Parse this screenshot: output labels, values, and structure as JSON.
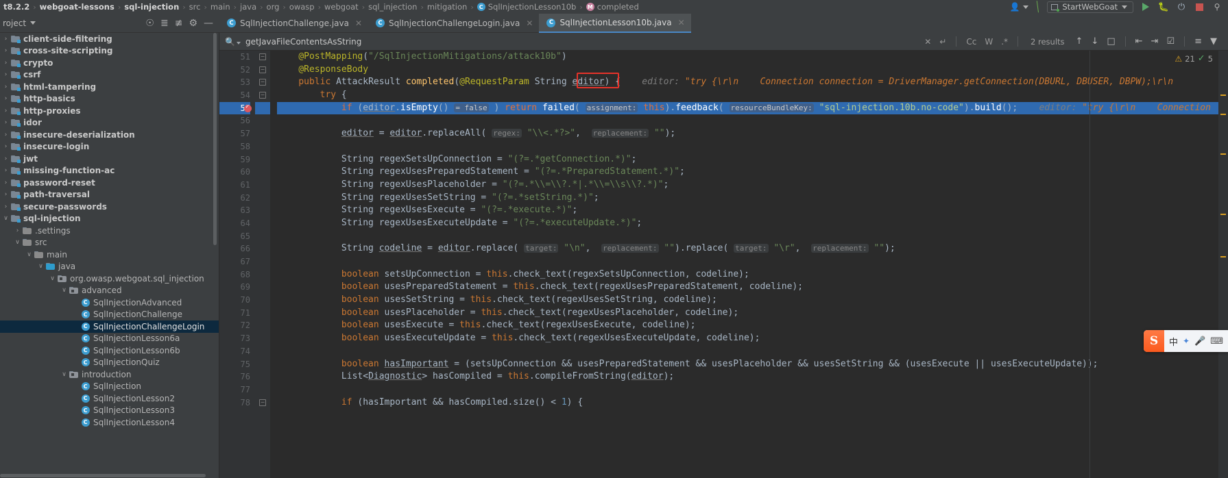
{
  "navbar": {
    "crumbs": [
      {
        "label": "t8.2.2",
        "bold": true,
        "icon": ""
      },
      {
        "label": "webgoat-lessons",
        "bold": true,
        "icon": ""
      },
      {
        "label": "sql-injection",
        "bold": true,
        "icon": ""
      },
      {
        "label": "src",
        "bold": false,
        "icon": ""
      },
      {
        "label": "main",
        "bold": false,
        "icon": ""
      },
      {
        "label": "java",
        "bold": false,
        "icon": ""
      },
      {
        "label": "org",
        "bold": false,
        "icon": ""
      },
      {
        "label": "owasp",
        "bold": false,
        "icon": ""
      },
      {
        "label": "webgoat",
        "bold": false,
        "icon": ""
      },
      {
        "label": "sql_injection",
        "bold": false,
        "icon": ""
      },
      {
        "label": "mitigation",
        "bold": false,
        "icon": ""
      },
      {
        "label": "SqlInjectionLesson10b",
        "bold": false,
        "icon": "c"
      },
      {
        "label": "completed",
        "bold": false,
        "icon": "m"
      }
    ],
    "run_config": "StartWebGoat"
  },
  "project_toolbar": {
    "title": "roject"
  },
  "tabs": [
    {
      "label": "SqlInjectionChallenge.java",
      "active": false
    },
    {
      "label": "SqlInjectionChallengeLogin.java",
      "active": false
    },
    {
      "label": "SqlInjectionLesson10b.java",
      "active": true
    }
  ],
  "search": {
    "query": "getJavaFileContentsAsString",
    "results": "2 results",
    "options": [
      "Cc",
      "W",
      ".*"
    ]
  },
  "tree": [
    {
      "label": "client-side-filtering",
      "indent": 0,
      "arrow": "right",
      "icon": "module",
      "bold": true
    },
    {
      "label": "cross-site-scripting",
      "indent": 0,
      "arrow": "right",
      "icon": "module",
      "bold": true
    },
    {
      "label": "crypto",
      "indent": 0,
      "arrow": "right",
      "icon": "module",
      "bold": true
    },
    {
      "label": "csrf",
      "indent": 0,
      "arrow": "right",
      "icon": "module",
      "bold": true
    },
    {
      "label": "html-tampering",
      "indent": 0,
      "arrow": "right",
      "icon": "module",
      "bold": true
    },
    {
      "label": "http-basics",
      "indent": 0,
      "arrow": "right",
      "icon": "module",
      "bold": true
    },
    {
      "label": "http-proxies",
      "indent": 0,
      "arrow": "right",
      "icon": "module",
      "bold": true
    },
    {
      "label": "idor",
      "indent": 0,
      "arrow": "right",
      "icon": "module",
      "bold": true
    },
    {
      "label": "insecure-deserialization",
      "indent": 0,
      "arrow": "right",
      "icon": "module",
      "bold": true
    },
    {
      "label": "insecure-login",
      "indent": 0,
      "arrow": "right",
      "icon": "module",
      "bold": true
    },
    {
      "label": "jwt",
      "indent": 0,
      "arrow": "right",
      "icon": "module",
      "bold": true
    },
    {
      "label": "missing-function-ac",
      "indent": 0,
      "arrow": "right",
      "icon": "module",
      "bold": true
    },
    {
      "label": "password-reset",
      "indent": 0,
      "arrow": "right",
      "icon": "module",
      "bold": true
    },
    {
      "label": "path-traversal",
      "indent": 0,
      "arrow": "right",
      "icon": "module",
      "bold": true
    },
    {
      "label": "secure-passwords",
      "indent": 0,
      "arrow": "right",
      "icon": "module",
      "bold": true
    },
    {
      "label": "sql-injection",
      "indent": 0,
      "arrow": "down",
      "icon": "module",
      "bold": true
    },
    {
      "label": ".settings",
      "indent": 1,
      "arrow": "right",
      "icon": "folder",
      "bold": false
    },
    {
      "label": "src",
      "indent": 1,
      "arrow": "down",
      "icon": "folder",
      "bold": false
    },
    {
      "label": "main",
      "indent": 2,
      "arrow": "down",
      "icon": "folder",
      "bold": false
    },
    {
      "label": "java",
      "indent": 3,
      "arrow": "down",
      "icon": "source",
      "bold": false
    },
    {
      "label": "org.owasp.webgoat.sql_injection",
      "indent": 4,
      "arrow": "down",
      "icon": "package",
      "bold": false
    },
    {
      "label": "advanced",
      "indent": 5,
      "arrow": "down",
      "icon": "package",
      "bold": false
    },
    {
      "label": "SqlInjectionAdvanced",
      "indent": 6,
      "arrow": "none",
      "icon": "class",
      "bold": false
    },
    {
      "label": "SqlInjectionChallenge",
      "indent": 6,
      "arrow": "none",
      "icon": "class",
      "bold": false
    },
    {
      "label": "SqlInjectionChallengeLogin",
      "indent": 6,
      "arrow": "none",
      "icon": "class",
      "bold": false,
      "selected": true
    },
    {
      "label": "SqlInjectionLesson6a",
      "indent": 6,
      "arrow": "none",
      "icon": "class",
      "bold": false
    },
    {
      "label": "SqlInjectionLesson6b",
      "indent": 6,
      "arrow": "none",
      "icon": "class",
      "bold": false
    },
    {
      "label": "SqlInjectionQuiz",
      "indent": 6,
      "arrow": "none",
      "icon": "class",
      "bold": false
    },
    {
      "label": "introduction",
      "indent": 5,
      "arrow": "down",
      "icon": "package",
      "bold": false
    },
    {
      "label": "SqlInjection",
      "indent": 6,
      "arrow": "none",
      "icon": "class",
      "bold": false
    },
    {
      "label": "SqlInjectionLesson2",
      "indent": 6,
      "arrow": "none",
      "icon": "class",
      "bold": false
    },
    {
      "label": "SqlInjectionLesson3",
      "indent": 6,
      "arrow": "none",
      "icon": "class",
      "bold": false
    },
    {
      "label": "SqlInjectionLesson4",
      "indent": 6,
      "arrow": "none",
      "icon": "class",
      "bold": false
    }
  ],
  "editor": {
    "first_line": 51,
    "highlighted_line": 55,
    "breakpoint_line": 55,
    "inspection": {
      "warnings": "21",
      "ok": "5"
    },
    "lines": [
      {
        "n": 51,
        "fold": "collapse",
        "html": "    <span class='ann'>@PostMapping</span>(<span class='str'>\"/SqlInjectionMitigations/attack10b\"</span>)"
      },
      {
        "n": 52,
        "fold": "collapse-top",
        "html": "    <span class='ann'>@ResponseBody</span>"
      },
      {
        "n": 53,
        "fold": "collapse",
        "html": "    <span class='kw'>public</span> <span class='ident'>AttackResult</span> <span class='fn'>completed</span>(<span class='ann'>@RequestParam</span> <span class='ident'>String</span> <span class='underl'>editor</span>) {    <span class='ghost'>editor:</span> <span class='ghost-o'>\"try {\\r\\n    Connection connection = DriverManager.getConnection(DBURL, DBUSER, DBPW);\\r\\n</span>"
      },
      {
        "n": 54,
        "fold": "collapse",
        "html": "        <span class='kw'>try</span> {"
      },
      {
        "n": 55,
        "fold": "",
        "hl": true,
        "html": "            <span class='kw'>if</span> (<span class='underl'>editor</span>.<span class='ident'>isEmpty</span>() <span class='inlayparam'>= false</span> ) <span class='kw'>return</span> <span class='ident'>failed</span>( <span class='inlayparam'>assignment:</span> <span class='kw'>this</span>).<span class='ident'>feedback</span>( <span class='inlayparam'>resourceBundleKey:</span> <span class='str'>\"sql-injection.10b.no-code\"</span>).<span class='ident'>build</span>();    <span class='ghost'>editor:</span> <span class='ghost-o'>\"try {\\r\\n    Connection</span>"
      },
      {
        "n": 56,
        "fold": "",
        "html": ""
      },
      {
        "n": 57,
        "fold": "",
        "html": "            <span class='underl'>editor</span> = <span class='underl'>editor</span>.<span class='ident'>replaceAll</span>( <span class='inlayparam'>regex:</span> <span class='str'>\"\\\\&lt;.*?&gt;\"</span>,  <span class='inlayparam'>replacement:</span> <span class='str'>\"\"</span>);"
      },
      {
        "n": 58,
        "fold": "",
        "html": ""
      },
      {
        "n": 59,
        "fold": "",
        "html": "            <span class='ident'>String</span> regexSetsUpConnection = <span class='str'>\"(?=.*getConnection.*)\"</span>;"
      },
      {
        "n": 60,
        "fold": "",
        "html": "            <span class='ident'>String</span> regexUsesPreparedStatement = <span class='str'>\"(?=.*PreparedStatement.*)\"</span>;"
      },
      {
        "n": 61,
        "fold": "",
        "html": "            <span class='ident'>String</span> regexUsesPlaceholder = <span class='str'>\"(?=.*\\\\=\\\\?.*|.*\\\\=\\\\s\\\\?.*)\"</span>;"
      },
      {
        "n": 62,
        "fold": "",
        "html": "            <span class='ident'>String</span> regexUsesSetString = <span class='str'>\"(?=.*setString.*)\"</span>;"
      },
      {
        "n": 63,
        "fold": "",
        "html": "            <span class='ident'>String</span> regexUsesExecute = <span class='str'>\"(?=.*execute.*)\"</span>;"
      },
      {
        "n": 64,
        "fold": "",
        "html": "            <span class='ident'>String</span> regexUsesExecuteUpdate = <span class='str'>\"(?=.*executeUpdate.*)\"</span>;"
      },
      {
        "n": 65,
        "fold": "",
        "html": ""
      },
      {
        "n": 66,
        "fold": "",
        "html": "            <span class='ident'>String</span> <span class='underl'>codeline</span> = <span class='underl'>editor</span>.<span class='ident'>replace</span>( <span class='inlayparam'>target:</span> <span class='str'>\"\\n\"</span>,  <span class='inlayparam'>replacement:</span> <span class='str'>\"\"</span>).<span class='ident'>replace</span>( <span class='inlayparam'>target:</span> <span class='str'>\"\\r\"</span>,  <span class='inlayparam'>replacement:</span> <span class='str'>\"\"</span>);"
      },
      {
        "n": 67,
        "fold": "",
        "html": ""
      },
      {
        "n": 68,
        "fold": "",
        "html": "            <span class='kw'>boolean</span> setsUpConnection = <span class='kw'>this</span>.<span class='ident'>check_text</span>(regexSetsUpConnection, codeline);"
      },
      {
        "n": 69,
        "fold": "",
        "html": "            <span class='kw'>boolean</span> usesPreparedStatement = <span class='kw'>this</span>.<span class='ident'>check_text</span>(regexUsesPreparedStatement, codeline);"
      },
      {
        "n": 70,
        "fold": "",
        "html": "            <span class='kw'>boolean</span> usesSetString = <span class='kw'>this</span>.<span class='ident'>check_text</span>(regexUsesSetString, codeline);"
      },
      {
        "n": 71,
        "fold": "",
        "html": "            <span class='kw'>boolean</span> usesPlaceholder = <span class='kw'>this</span>.<span class='ident'>check_text</span>(regexUsesPlaceholder, codeline);"
      },
      {
        "n": 72,
        "fold": "",
        "html": "            <span class='kw'>boolean</span> usesExecute = <span class='kw'>this</span>.<span class='ident'>check_text</span>(regexUsesExecute, codeline);"
      },
      {
        "n": 73,
        "fold": "",
        "html": "            <span class='kw'>boolean</span> usesExecuteUpdate = <span class='kw'>this</span>.<span class='ident'>check_text</span>(regexUsesExecuteUpdate, codeline);"
      },
      {
        "n": 74,
        "fold": "",
        "html": ""
      },
      {
        "n": 75,
        "fold": "",
        "html": "            <span class='kw'>boolean</span> <span class='underl'>hasImportant</span> = (setsUpConnection &amp;&amp; usesPreparedStatement &amp;&amp; usesPlaceholder &amp;&amp; usesSetString &amp;&amp; (usesExecute || usesExecuteUpdate));"
      },
      {
        "n": 76,
        "fold": "",
        "html": "            List&lt;<span class='underl'>Diagnostic</span>&gt; hasCompiled = <span class='kw'>this</span>.<span class='ident'>compileFromString</span>(<span class='underl'>editor</span>);"
      },
      {
        "n": 77,
        "fold": "",
        "html": ""
      },
      {
        "n": 78,
        "fold": "collapse",
        "html": "            <span class='kw'>if</span> (hasImportant &amp;&amp; hasCompiled.<span class='ident'>size</span>() &lt; <span class='num'>1</span>) {"
      }
    ]
  },
  "ime": {
    "logo": "S",
    "mode": "中",
    "icons": [
      "sparkle-icon",
      "mic-icon",
      "keyboard-icon"
    ]
  }
}
